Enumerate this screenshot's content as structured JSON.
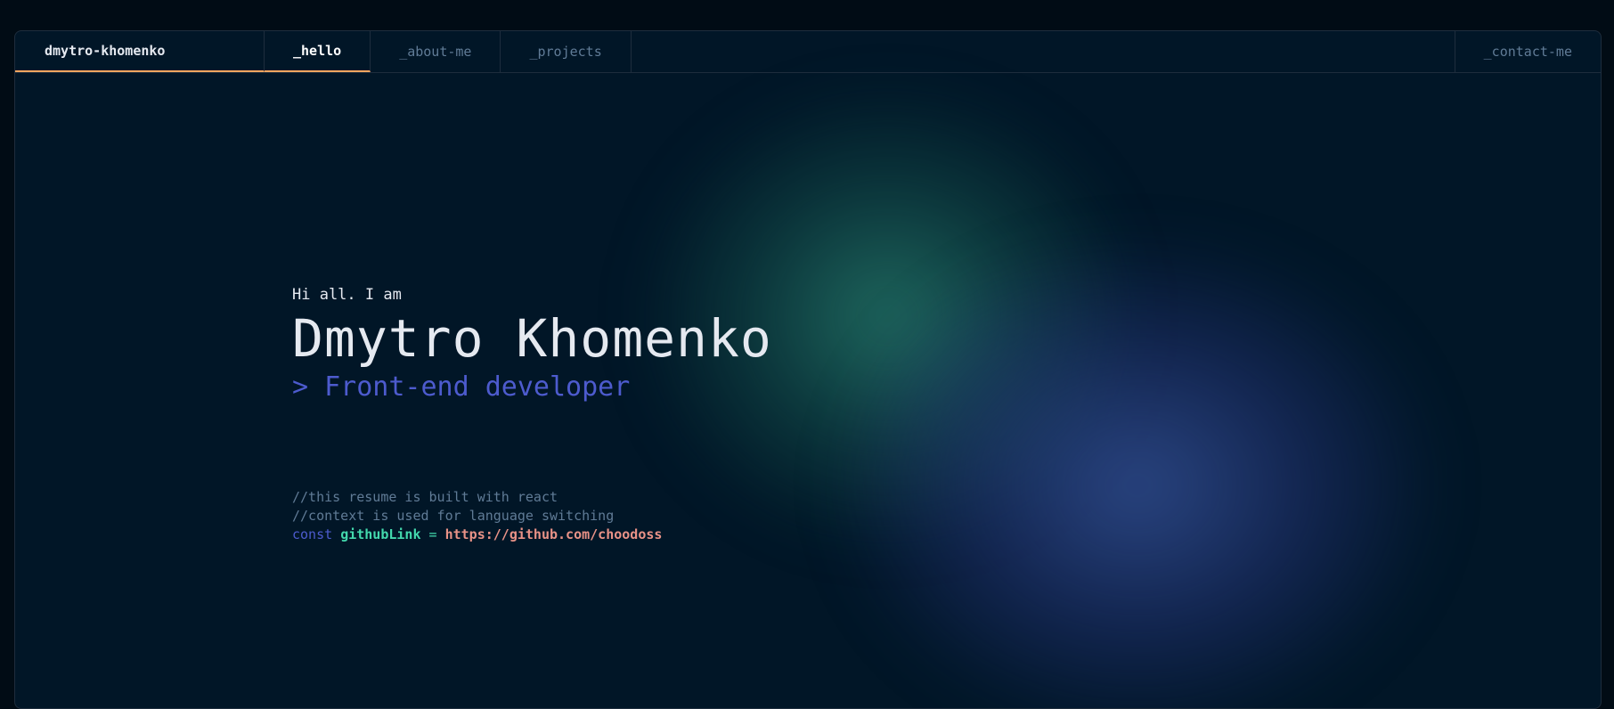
{
  "nav": {
    "brand": "dmytro-khomenko",
    "tabs": [
      {
        "label": "_hello"
      },
      {
        "label": "_about-me"
      },
      {
        "label": "_projects"
      }
    ],
    "contact": "_contact-me"
  },
  "hero": {
    "greeting": "Hi all. I am",
    "name": "Dmytro Khomenko",
    "role": "> Front-end developer",
    "comments": [
      "//this resume is built with react",
      "//context is used for language switching"
    ],
    "code": {
      "keyword": "const",
      "variable": "githubLink",
      "operator": "=",
      "value": "https://github.com/choodoss"
    }
  },
  "colors": {
    "background": "#011627",
    "accent_orange": "#fea55f",
    "accent_blue": "#4d5bce",
    "accent_green": "#43d9ad",
    "string_salmon": "#e99287",
    "muted_text": "#607b96"
  }
}
